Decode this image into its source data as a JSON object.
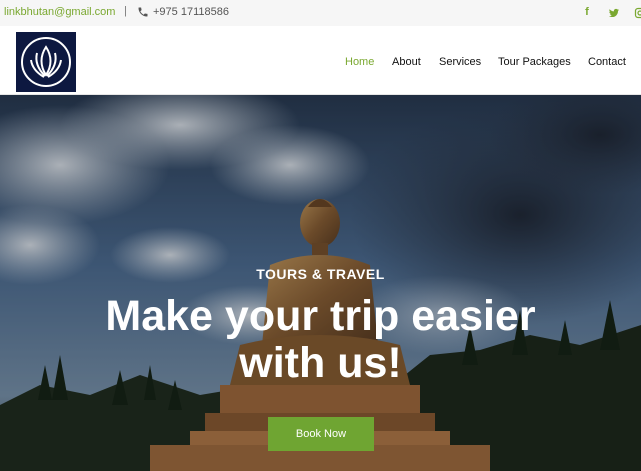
{
  "topbar": {
    "email": "linkbhutan@gmail.com",
    "separator": "|",
    "phone": "+975 17118586",
    "social_icons": [
      "facebook-icon",
      "twitter-icon",
      "instagram-icon"
    ],
    "accent": "#7aa830"
  },
  "nav": {
    "items": [
      "Home",
      "About",
      "Services",
      "Tour Packages",
      "Contact"
    ],
    "active": "Home"
  },
  "hero": {
    "eyebrow": "TOURS & TRAVEL",
    "headline_line1": "Make your trip easier",
    "headline_line2": "with us!",
    "button_label": "Book Now",
    "button_color": "#6fa532"
  }
}
